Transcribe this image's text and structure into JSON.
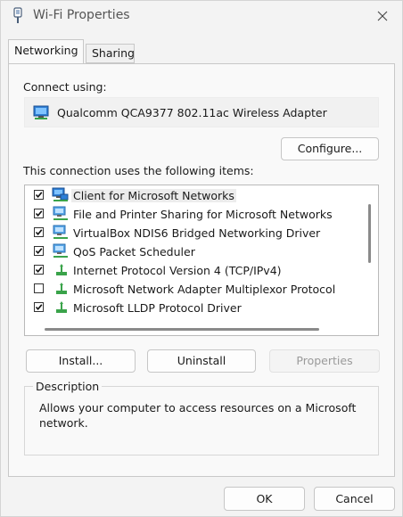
{
  "window": {
    "title": "Wi-Fi Properties",
    "close_icon": "close-icon"
  },
  "tabs": [
    {
      "label": "Networking",
      "active": true
    },
    {
      "label": "Sharing",
      "active": false
    }
  ],
  "networking": {
    "connect_using_label": "Connect using:",
    "adapter": {
      "icon": "network-adapter-icon",
      "name": "Qualcomm QCA9377 802.11ac Wireless Adapter"
    },
    "configure_label": "Configure...",
    "items_label": "This connection uses the following items:",
    "items": [
      {
        "label": "Client for Microsoft Networks",
        "checked": true,
        "icon": "network-client-icon",
        "selected": true
      },
      {
        "label": "File and Printer Sharing for Microsoft Networks",
        "checked": true,
        "icon": "network-service-icon",
        "selected": false
      },
      {
        "label": "VirtualBox NDIS6 Bridged Networking Driver",
        "checked": true,
        "icon": "network-service-icon",
        "selected": false
      },
      {
        "label": "QoS Packet Scheduler",
        "checked": true,
        "icon": "network-service-icon",
        "selected": false
      },
      {
        "label": "Internet Protocol Version 4 (TCP/IPv4)",
        "checked": true,
        "icon": "protocol-icon",
        "selected": false
      },
      {
        "label": "Microsoft Network Adapter Multiplexor Protocol",
        "checked": false,
        "icon": "protocol-icon",
        "selected": false
      },
      {
        "label": "Microsoft LLDP Protocol Driver",
        "checked": true,
        "icon": "protocol-icon",
        "selected": false
      }
    ],
    "install_label": "Install...",
    "uninstall_label": "Uninstall",
    "properties_label": "Properties",
    "description": {
      "legend": "Description",
      "text": "Allows your computer to access resources on a Microsoft network."
    }
  },
  "footer": {
    "ok_label": "OK",
    "cancel_label": "Cancel"
  },
  "colors": {
    "window_bg": "#f3f3f3",
    "panel_bg": "#f9f9f9",
    "disabled_text": "#9a9a9a"
  }
}
